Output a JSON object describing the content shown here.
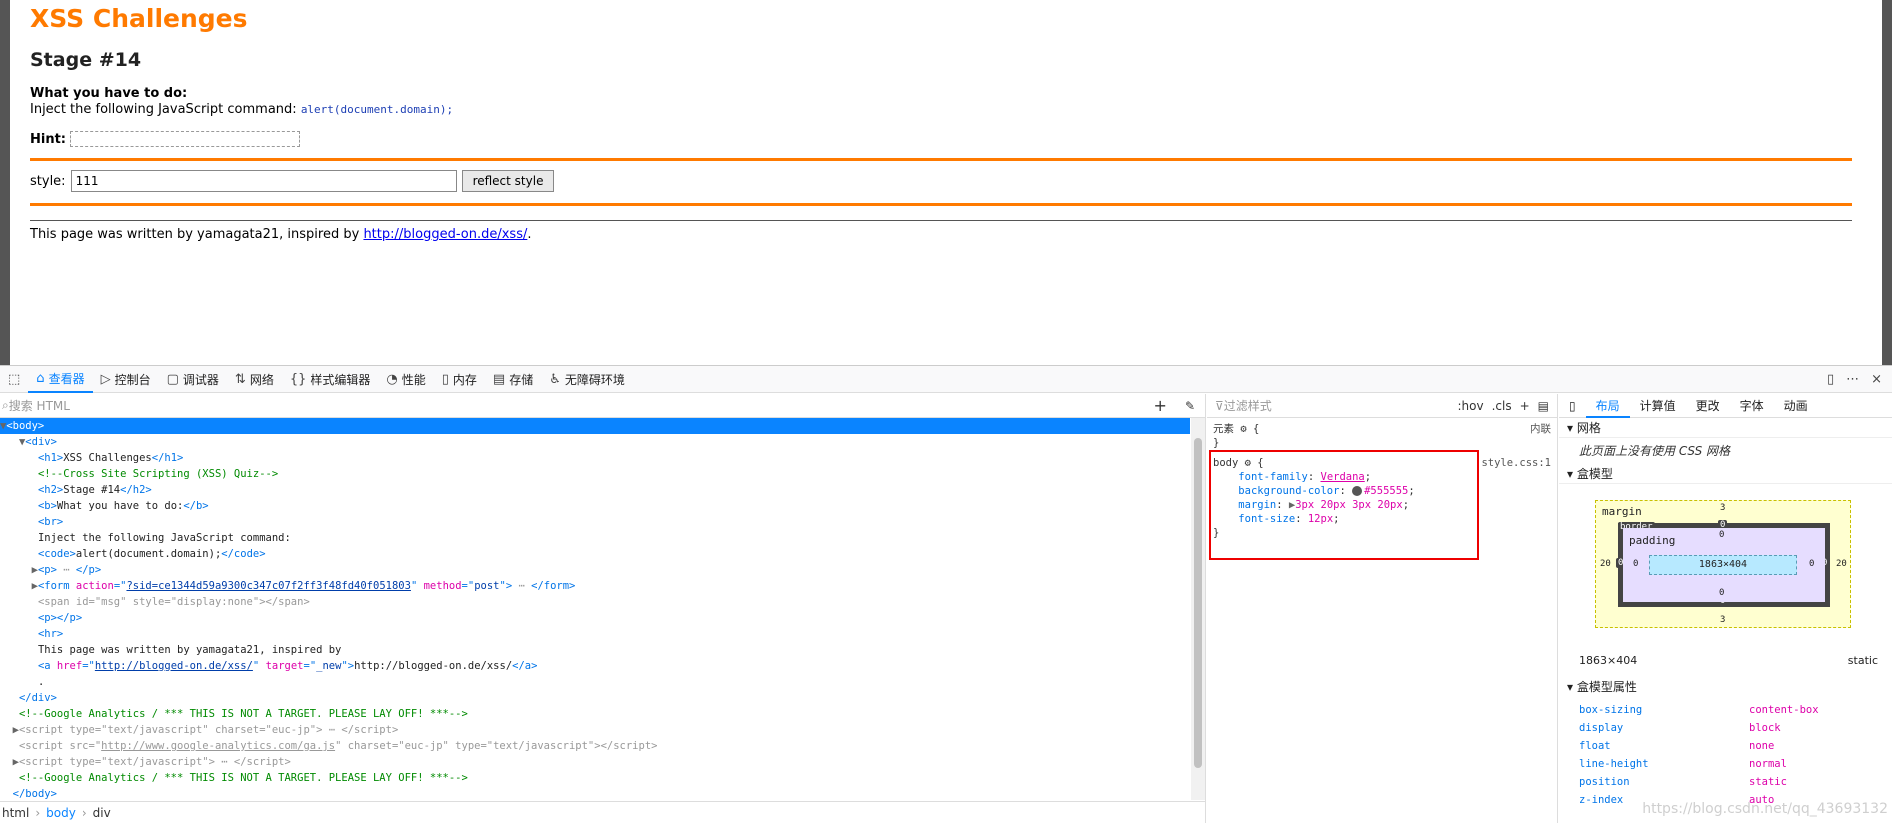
{
  "page": {
    "title": "XSS Challenges",
    "stage": "Stage #14",
    "todo_label": "What you have to do:",
    "inject_text": "Inject the following JavaScript command:",
    "inject_code": "alert(document.domain);",
    "hint_label": "Hint:",
    "style_label": "style:",
    "style_value": "111",
    "reflect_button": "reflect style",
    "footer_text": "This page was written by yamagata21, inspired by",
    "footer_link": "http://blogged-on.de/xss/",
    "footer_end": "."
  },
  "devtools": {
    "tabs": [
      {
        "icon": "⌂",
        "label": "查看器"
      },
      {
        "icon": "▷",
        "label": "控制台"
      },
      {
        "icon": "▢",
        "label": "调试器"
      },
      {
        "icon": "⇅",
        "label": "网络"
      },
      {
        "icon": "{}",
        "label": "样式编辑器"
      },
      {
        "icon": "◔",
        "label": "性能"
      },
      {
        "icon": "▯",
        "label": "内存"
      },
      {
        "icon": "▤",
        "label": "存储"
      },
      {
        "icon": "♿",
        "label": "无障碍环境"
      }
    ],
    "search_placeholder": "搜索 HTML",
    "breadcrumb": [
      "html",
      "body",
      "div"
    ],
    "rules_filter": "过滤样式",
    "hov": ":hov",
    "cls": ".cls",
    "element_label": "元素",
    "inline_label": "内联",
    "rule_selector": "body",
    "rule_source": "style.css:1",
    "rule_props": [
      {
        "name": "font-family",
        "value": "Verdana"
      },
      {
        "name": "background-color",
        "value": "#555555"
      },
      {
        "name": "margin",
        "value": "3px 20px 3px 20px"
      },
      {
        "name": "font-size",
        "value": "12px"
      }
    ],
    "layout_tabs": [
      "布局",
      "计算值",
      "更改",
      "字体",
      "动画"
    ],
    "grid_head": "网格",
    "grid_msg": "此页面上没有使用 CSS 网格",
    "boxmodel_head": "盒模型",
    "bm": {
      "margin_label": "margin",
      "border_label": "border",
      "padding_label": "padding",
      "margin_top": "3",
      "margin_bottom": "3",
      "margin_left": "20",
      "margin_right": "20",
      "border_val": "0",
      "padding_val": "0",
      "content_size": "1863×404"
    },
    "size_text": "1863×404",
    "position_text": "static",
    "props_head": "盒模型属性",
    "box_props": [
      {
        "name": "box-sizing",
        "value": "content-box"
      },
      {
        "name": "display",
        "value": "block"
      },
      {
        "name": "float",
        "value": "none"
      },
      {
        "name": "line-height",
        "value": "normal"
      },
      {
        "name": "position",
        "value": "static"
      },
      {
        "name": "z-index",
        "value": "auto"
      }
    ],
    "watermark": "https://blog.csdn.net/qq_43693132"
  }
}
